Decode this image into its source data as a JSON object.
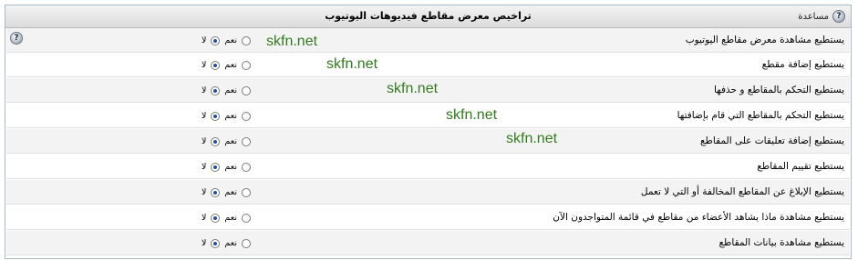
{
  "header": {
    "title": "تراخيص معرض مقاطع فيديوهات اليوتيوب",
    "help_label": "مساعدة",
    "help_icon": "question-icon"
  },
  "options": {
    "yes": "نعم",
    "no": "لا"
  },
  "rows": [
    {
      "label": "يستطيع مشاهدة معرض مقاطع اليوتيوب",
      "selected": "no",
      "has_help": true
    },
    {
      "label": "يستطيع إضافة مقطع",
      "selected": "no"
    },
    {
      "label": "يستطيع التحكم بالمقاطع و حذفها",
      "selected": "no"
    },
    {
      "label": "يستطيع التحكم بالمقاطع التي قام بإضافتها",
      "selected": "no"
    },
    {
      "label": "يستطيع إضافة تعليقات على المقاطع",
      "selected": "no"
    },
    {
      "label": "يستطيع تقييم المقاطع",
      "selected": "no"
    },
    {
      "label": "يستطيع الإبلاغ عن المقاطع المخالفة أو التي لا تعمل",
      "selected": "no"
    },
    {
      "label": "يستطيع مشاهدة ماذا يشاهد الأعضاء من مقاطع في قائمة المتواجدون الآن",
      "selected": "no"
    },
    {
      "label": "يستطيع مشاهدة بيانات المقاطع",
      "selected": "no"
    }
  ],
  "watermark": {
    "text": "skfn.net",
    "color": "#2f7a1a"
  }
}
